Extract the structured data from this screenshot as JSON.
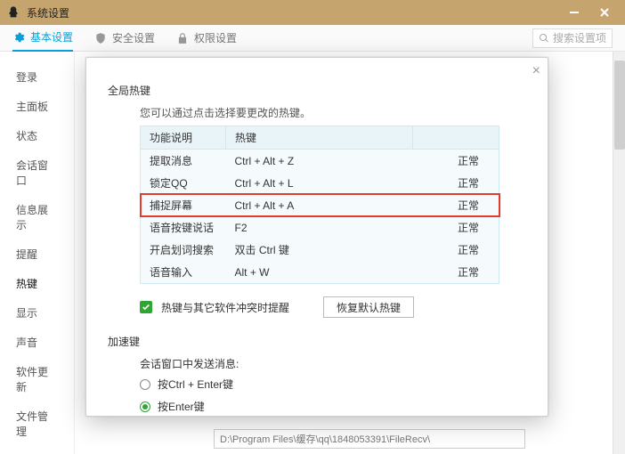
{
  "window": {
    "title": "系统设置"
  },
  "tabs": {
    "basic": {
      "label": "基本设置"
    },
    "security": {
      "label": "安全设置"
    },
    "privacy": {
      "label": "权限设置"
    }
  },
  "search": {
    "placeholder": "搜索设置项"
  },
  "sidebar": {
    "items": [
      {
        "label": "登录"
      },
      {
        "label": "主面板"
      },
      {
        "label": "状态"
      },
      {
        "label": "会话窗口"
      },
      {
        "label": "信息展示"
      },
      {
        "label": "提醒"
      },
      {
        "label": "热键"
      },
      {
        "label": "显示"
      },
      {
        "label": "声音"
      },
      {
        "label": "软件更新"
      },
      {
        "label": "文件管理"
      }
    ]
  },
  "path": {
    "value": "D:\\Program Files\\缓存\\qq\\1848053391\\FileRecv\\"
  },
  "hotkeys": {
    "section": "全局热键",
    "desc": "您可以通过点击选择要更改的热键。",
    "headers": {
      "func": "功能说明",
      "key": "热键",
      "stat": ""
    },
    "rows": [
      {
        "func": "提取消息",
        "key": "Ctrl + Alt + Z",
        "stat": "正常",
        "hl": false
      },
      {
        "func": "锁定QQ",
        "key": "Ctrl + Alt + L",
        "stat": "正常",
        "hl": false
      },
      {
        "func": "捕捉屏幕",
        "key": "Ctrl + Alt + A",
        "stat": "正常",
        "hl": true
      },
      {
        "func": "语音按键说话",
        "key": "F2",
        "stat": "正常",
        "hl": false
      },
      {
        "func": "开启划词搜索",
        "key": "双击 Ctrl 键",
        "stat": "正常",
        "hl": false
      },
      {
        "func": "语音输入",
        "key": "Alt + W",
        "stat": "正常",
        "hl": false
      }
    ],
    "conflict_label": "热键与其它软件冲突时提醒",
    "restore_btn": "恢复默认热键"
  },
  "accel": {
    "section": "加速键",
    "send_label": "会话窗口中发送消息:",
    "radios": [
      {
        "label": "按Ctrl + Enter键",
        "on": false
      },
      {
        "label": "按Enter键",
        "on": true
      }
    ]
  }
}
